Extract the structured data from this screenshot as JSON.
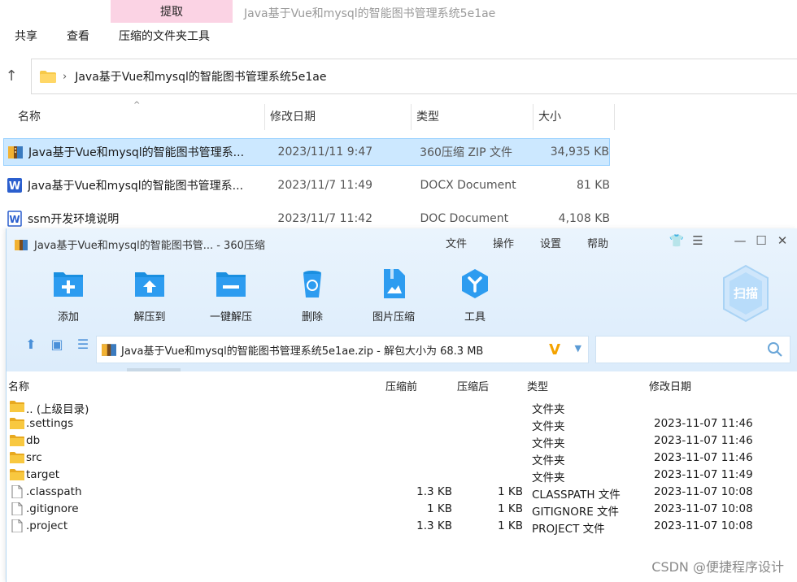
{
  "explorer": {
    "context_tab": "提取",
    "window_title": "Java基于Vue和mysql的智能图书管理系统5e1ae",
    "ribbon": [
      "共享",
      "查看",
      "压缩的文件夹工具"
    ],
    "address_path": "Java基于Vue和mysql的智能图书管理系统5e1ae",
    "columns": {
      "name": "名称",
      "date": "修改日期",
      "type": "类型",
      "size": "大小"
    },
    "files": [
      {
        "name": "Java基于Vue和mysql的智能图书管理系...",
        "date": "2023/11/11 9:47",
        "type": "360压缩 ZIP 文件",
        "size": "34,935 KB",
        "icon": "zip-archive-icon",
        "selected": true
      },
      {
        "name": "Java基于Vue和mysql的智能图书管理系...",
        "date": "2023/11/7 11:49",
        "type": "DOCX Document",
        "size": "81 KB",
        "icon": "word-docx-icon",
        "selected": false
      },
      {
        "name": "ssm开发环境说明",
        "date": "2023/11/7 11:42",
        "type": "DOC Document",
        "size": "4,108 KB",
        "icon": "word-doc-icon",
        "selected": false
      }
    ]
  },
  "zip": {
    "title": "Java基于Vue和mysql的智能图书管... - 360压缩",
    "menu": [
      "文件",
      "操作",
      "设置",
      "帮助"
    ],
    "tools": [
      {
        "label": "添加",
        "icon": "add-icon"
      },
      {
        "label": "解压到",
        "icon": "extract-to-icon"
      },
      {
        "label": "一键解压",
        "icon": "one-click-extract-icon"
      },
      {
        "label": "删除",
        "icon": "delete-icon"
      },
      {
        "label": "图片压缩",
        "icon": "image-compress-icon"
      },
      {
        "label": "工具",
        "icon": "tools-icon"
      }
    ],
    "scan_label": "扫描",
    "address": "Java基于Vue和mysql的智能图书管理系统5e1ae.zip - 解包大小为 68.3 MB",
    "columns": {
      "name": "名称",
      "before": "压缩前",
      "after": "压缩后",
      "type": "类型",
      "date": "修改日期"
    },
    "rows": [
      {
        "name": ".. (上级目录)",
        "before": "",
        "after": "",
        "type": "文件夹",
        "date": "",
        "kind": "folder"
      },
      {
        "name": ".settings",
        "before": "",
        "after": "",
        "type": "文件夹",
        "date": "2023-11-07 11:46",
        "kind": "folder"
      },
      {
        "name": "db",
        "before": "",
        "after": "",
        "type": "文件夹",
        "date": "2023-11-07 11:46",
        "kind": "folder"
      },
      {
        "name": "src",
        "before": "",
        "after": "",
        "type": "文件夹",
        "date": "2023-11-07 11:46",
        "kind": "folder"
      },
      {
        "name": "target",
        "before": "",
        "after": "",
        "type": "文件夹",
        "date": "2023-11-07 11:49",
        "kind": "folder"
      },
      {
        "name": ".classpath",
        "before": "1.3 KB",
        "after": "1 KB",
        "type": "CLASSPATH 文件",
        "date": "2023-11-07 10:08",
        "kind": "file"
      },
      {
        "name": ".gitignore",
        "before": "1 KB",
        "after": "1 KB",
        "type": "GITIGNORE 文件",
        "date": "2023-11-07 10:08",
        "kind": "file"
      },
      {
        "name": ".project",
        "before": "1.3 KB",
        "after": "1 KB",
        "type": "PROJECT 文件",
        "date": "2023-11-07 10:08",
        "kind": "file"
      }
    ]
  },
  "watermark": "CSDN @便捷程序设计",
  "colors": {
    "selection": "#cce8ff",
    "accent": "#1a8fe0",
    "context_tab": "#fbd3e4"
  }
}
